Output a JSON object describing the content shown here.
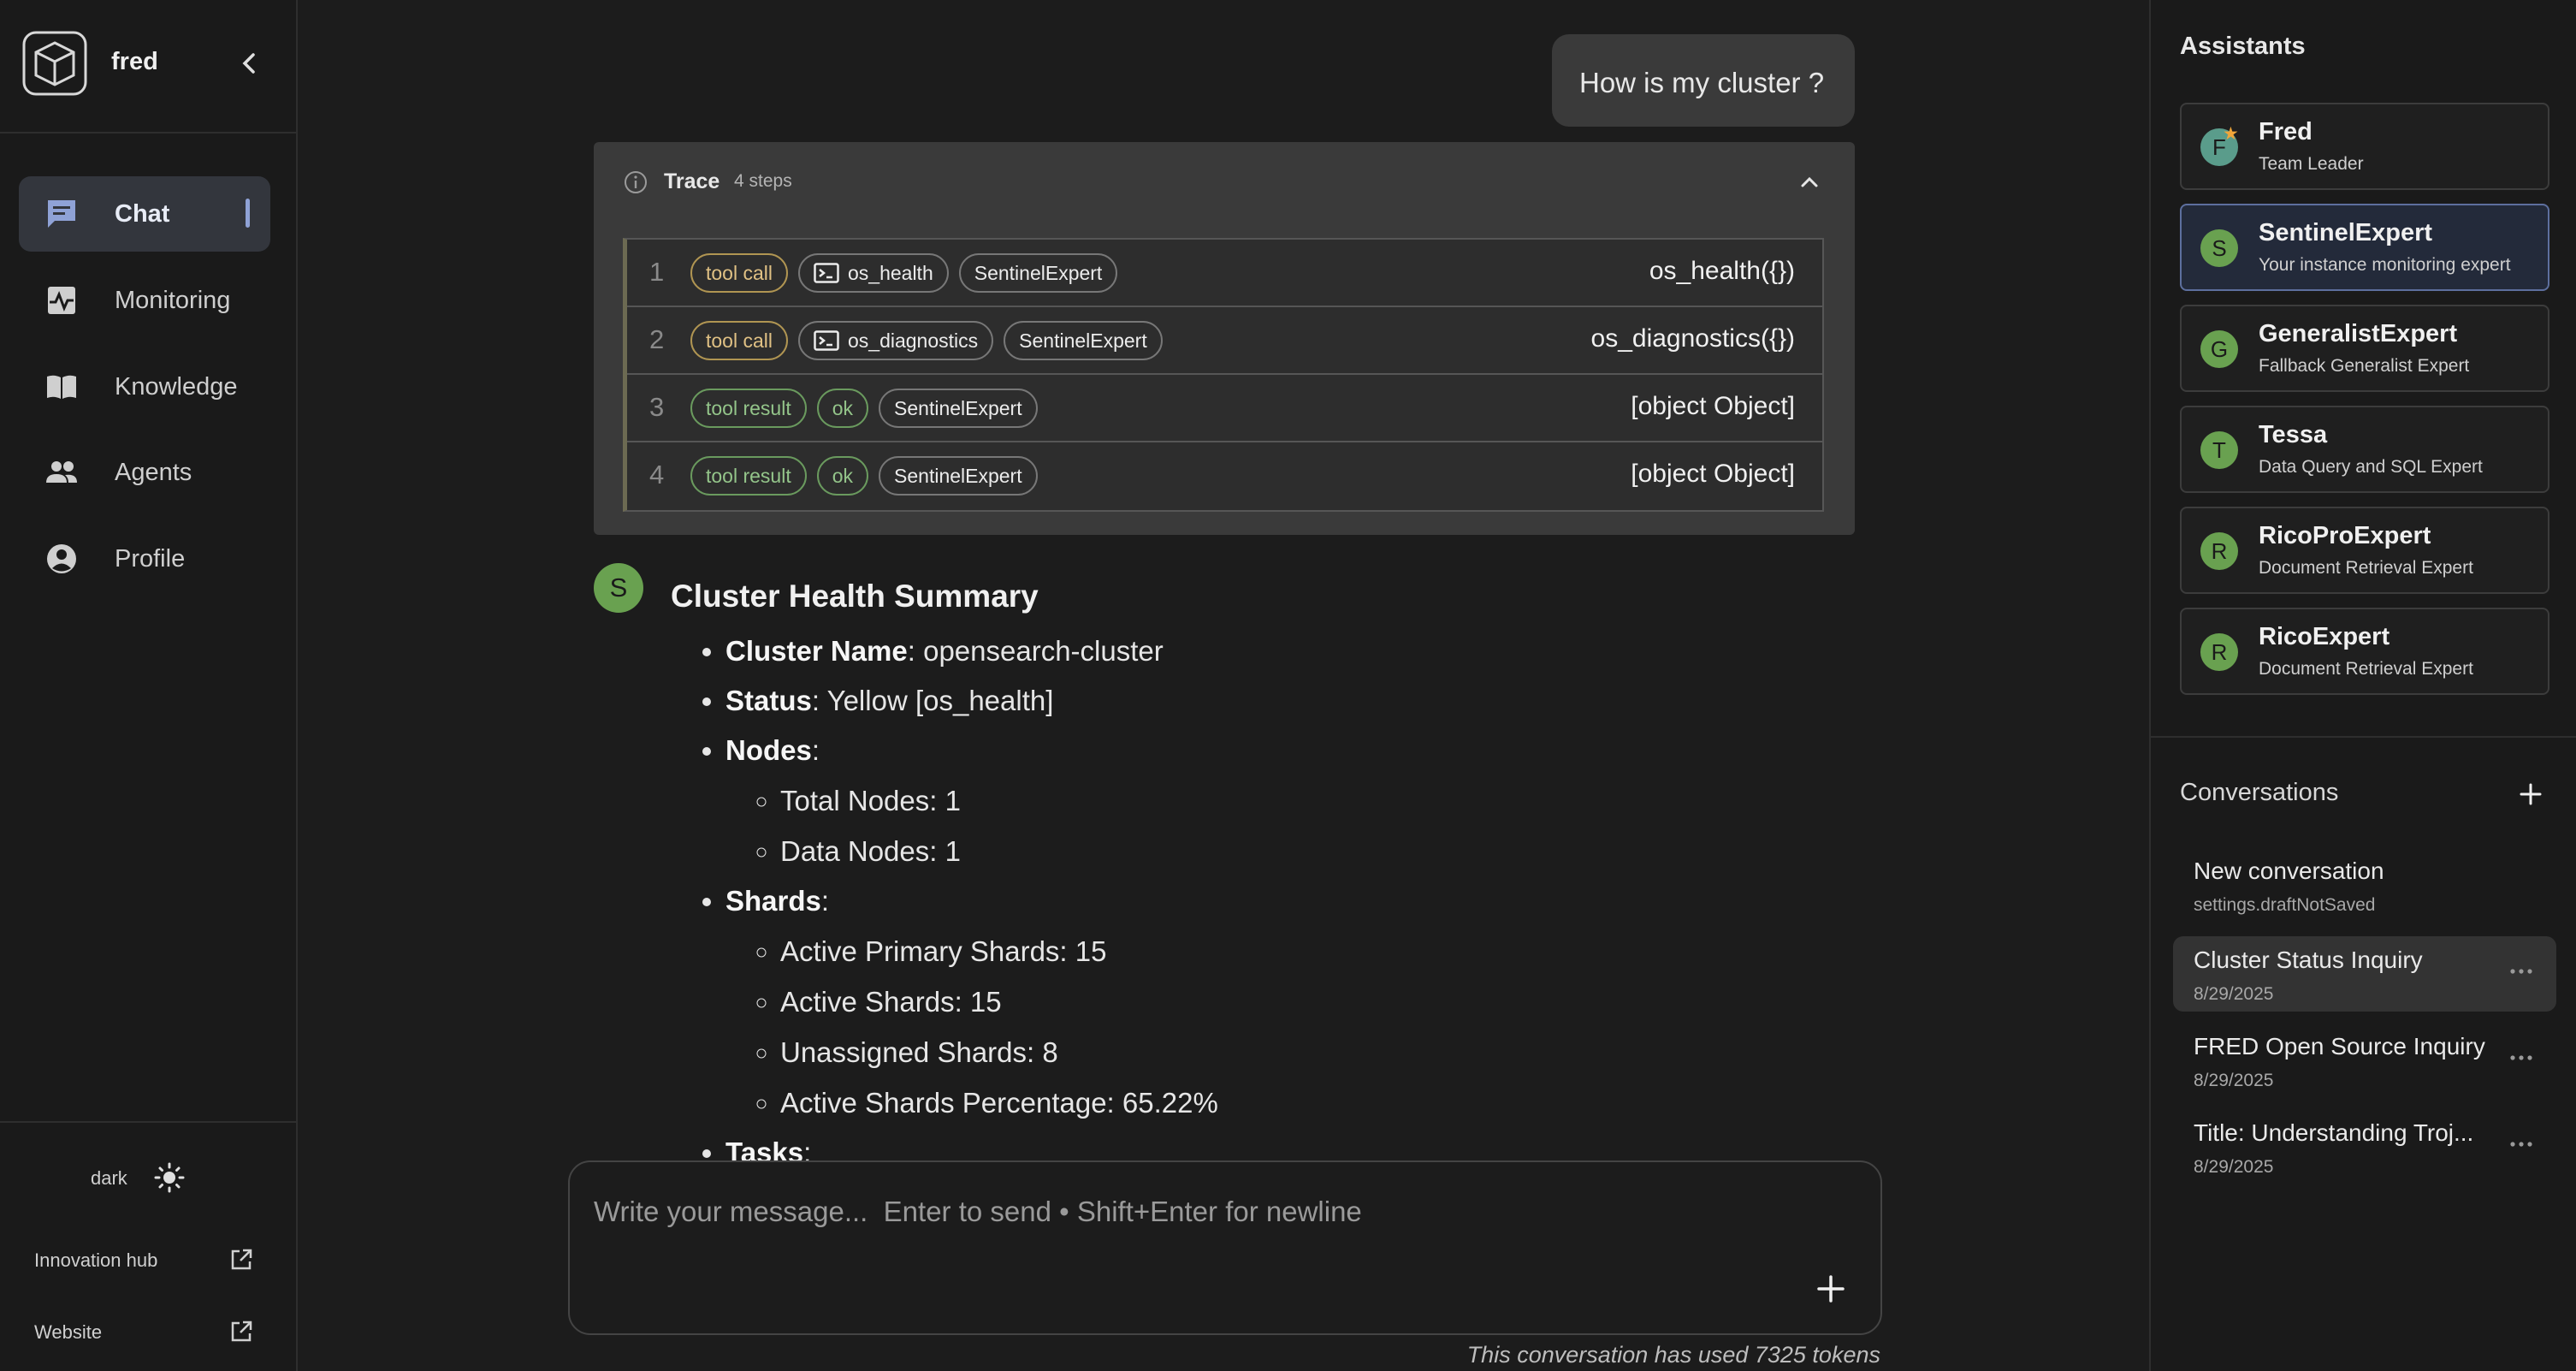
{
  "app": {
    "brand": "fred"
  },
  "nav": {
    "items": [
      {
        "label": "Chat",
        "icon": "chat-icon",
        "active": true
      },
      {
        "label": "Monitoring",
        "icon": "monitoring-icon",
        "active": false
      },
      {
        "label": "Knowledge",
        "icon": "book-icon",
        "active": false
      },
      {
        "label": "Agents",
        "icon": "people-icon",
        "active": false
      },
      {
        "label": "Profile",
        "icon": "account-icon",
        "active": false
      }
    ]
  },
  "sidebar_footer": {
    "theme_label": "dark",
    "theme_icon": "sun-icon",
    "links": [
      {
        "label": "Innovation hub",
        "icon": "external-link-icon"
      },
      {
        "label": "Website",
        "icon": "external-link-icon"
      }
    ]
  },
  "chat": {
    "user_message": "How is my cluster ?",
    "trace": {
      "title": "Trace",
      "steps_count": "4 steps",
      "steps": [
        {
          "num": "1",
          "kind": "tool call",
          "tool": "os_health",
          "agent": "SentinelExpert",
          "value": "os_health({})"
        },
        {
          "num": "2",
          "kind": "tool call",
          "tool": "os_diagnostics",
          "agent": "SentinelExpert",
          "value": "os_diagnostics({})"
        },
        {
          "num": "3",
          "kind": "tool result",
          "status": "ok",
          "agent": "SentinelExpert",
          "value": "[object Object]"
        },
        {
          "num": "4",
          "kind": "tool result",
          "status": "ok",
          "agent": "SentinelExpert",
          "value": "[object Object]"
        }
      ]
    },
    "bot_avatar": "S",
    "answer": {
      "title": "Cluster Health Summary",
      "cluster_name": {
        "label": "Cluster Name",
        "value": ": opensearch-cluster"
      },
      "status": {
        "label": "Status",
        "value": ": Yellow [os_health]"
      },
      "nodes": {
        "label": "Nodes",
        "suffix": ":",
        "items": [
          "Total Nodes: 1",
          "Data Nodes: 1"
        ]
      },
      "shards": {
        "label": "Shards",
        "suffix": ":",
        "items": [
          "Active Primary Shards: 15",
          "Active Shards: 15",
          "Unassigned Shards: 8",
          "Active Shards Percentage: 65.22%"
        ]
      },
      "tasks": {
        "label": "Tasks",
        "suffix": ":"
      }
    },
    "composer": {
      "placeholder": "Write your message...  Enter to send • Shift+Enter for newline"
    },
    "token_note": "This conversation has used 7325 tokens"
  },
  "assistants": {
    "title": "Assistants",
    "items": [
      {
        "initial": "F",
        "name": "Fred",
        "role": "Team Leader",
        "selected": false
      },
      {
        "initial": "S",
        "name": "SentinelExpert",
        "role": "Your instance monitoring expert",
        "selected": true
      },
      {
        "initial": "G",
        "name": "GeneralistExpert",
        "role": "Fallback Generalist Expert",
        "selected": false
      },
      {
        "initial": "T",
        "name": "Tessa",
        "role": "Data Query and SQL Expert",
        "selected": false
      },
      {
        "initial": "R",
        "name": "RicoProExpert",
        "role": "Document Retrieval Expert",
        "selected": false
      },
      {
        "initial": "R",
        "name": "RicoExpert",
        "role": "Document Retrieval Expert",
        "selected": false
      }
    ]
  },
  "conversations": {
    "title": "Conversations",
    "items": [
      {
        "title": "New conversation",
        "date": "settings.draftNotSaved",
        "selected": false
      },
      {
        "title": "Cluster Status Inquiry",
        "date": "8/29/2025",
        "selected": true
      },
      {
        "title": "FRED Open Source Inquiry",
        "date": "8/29/2025",
        "selected": false
      },
      {
        "title": "Title: Understanding Troj...",
        "date": "8/29/2025",
        "selected": false
      }
    ]
  },
  "colors": {
    "accent": "#8fa2d6",
    "avatar_green": "#69a150",
    "tool_call": "#e0c184",
    "tool_result": "#94c58a"
  }
}
